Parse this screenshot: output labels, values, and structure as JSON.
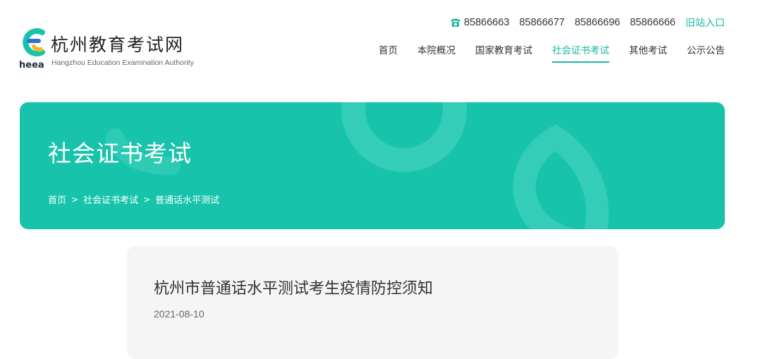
{
  "colors": {
    "accent": "#17b99f",
    "banner": "#17c4ab",
    "card": "#f5f5f5"
  },
  "header": {
    "logo": {
      "icon": "heea-logo-icon",
      "mark_text": "heea",
      "name_cn": "杭州教育考试网",
      "name_en": "Hangzhou Education Examination Authority"
    },
    "contact": {
      "icon": "phone-icon",
      "phones": [
        "85866663",
        "85866677",
        "85866696",
        "85866666"
      ],
      "old_site_label": "旧站入口"
    },
    "nav": [
      {
        "label": "首页",
        "active": false
      },
      {
        "label": "本院概况",
        "active": false
      },
      {
        "label": "国家教育考试",
        "active": false
      },
      {
        "label": "社会证书考试",
        "active": true
      },
      {
        "label": "其他考试",
        "active": false
      },
      {
        "label": "公示公告",
        "active": false
      }
    ]
  },
  "banner": {
    "title": "社会证书考试",
    "breadcrumb": [
      "首页",
      "社会证书考试",
      "普通话水平测试"
    ],
    "separator": ">"
  },
  "article": {
    "title": "杭州市普通话水平测试考生疫情防控须知",
    "date": "2021-08-10"
  }
}
